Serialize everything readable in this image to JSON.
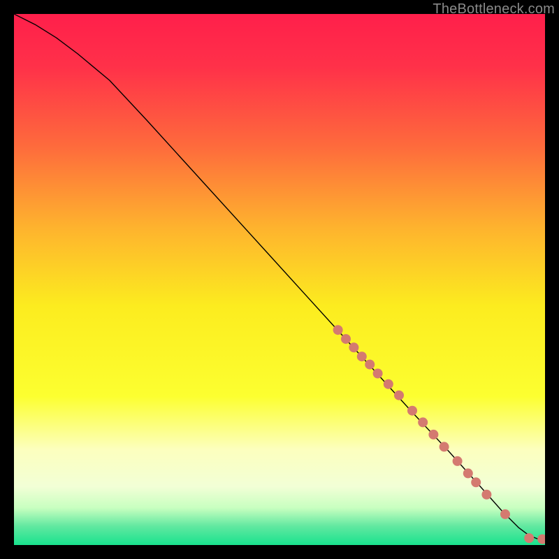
{
  "watermark": "TheBottleneck.com",
  "chart_data": {
    "type": "line",
    "title": "",
    "xlabel": "",
    "ylabel": "",
    "xlim": [
      0,
      100
    ],
    "ylim": [
      0,
      100
    ],
    "grid": false,
    "legend": false,
    "background_gradient": {
      "stops": [
        {
          "pos": 0.0,
          "color": "#ff1f4b"
        },
        {
          "pos": 0.1,
          "color": "#ff3149"
        },
        {
          "pos": 0.25,
          "color": "#fe6b3c"
        },
        {
          "pos": 0.4,
          "color": "#feb22e"
        },
        {
          "pos": 0.55,
          "color": "#fcec1f"
        },
        {
          "pos": 0.72,
          "color": "#fcff30"
        },
        {
          "pos": 0.82,
          "color": "#fcffbe"
        },
        {
          "pos": 0.89,
          "color": "#f2ffd6"
        },
        {
          "pos": 0.93,
          "color": "#c8ffc0"
        },
        {
          "pos": 0.965,
          "color": "#60e8a0"
        },
        {
          "pos": 1.0,
          "color": "#19e28e"
        }
      ]
    },
    "series": [
      {
        "name": "curve",
        "type": "line",
        "color": "#000000",
        "stroke_width": 1.4,
        "x": [
          0,
          4,
          8,
          12,
          18,
          25,
          35,
          45,
          55,
          65,
          75,
          82,
          88,
          92,
          95,
          97,
          98.5,
          100
        ],
        "y": [
          100,
          98,
          95.5,
          92.5,
          87.5,
          80,
          69,
          58,
          47,
          36,
          25,
          17.5,
          10.8,
          6.3,
          3.3,
          1.8,
          1.2,
          1.1
        ]
      },
      {
        "name": "dots",
        "type": "scatter",
        "color": "#d47a70",
        "radius": 7,
        "x": [
          61,
          62.5,
          64,
          65.5,
          67,
          68.5,
          70.5,
          72.5,
          75,
          77,
          79,
          81,
          83.5,
          85.5,
          87,
          89,
          92.5,
          97,
          99.5
        ],
        "y": [
          40.5,
          38.8,
          37.2,
          35.5,
          34,
          32.3,
          30.3,
          28.2,
          25.3,
          23.1,
          20.8,
          18.5,
          15.8,
          13.5,
          11.8,
          9.5,
          5.8,
          1.3,
          1.1
        ]
      }
    ]
  }
}
